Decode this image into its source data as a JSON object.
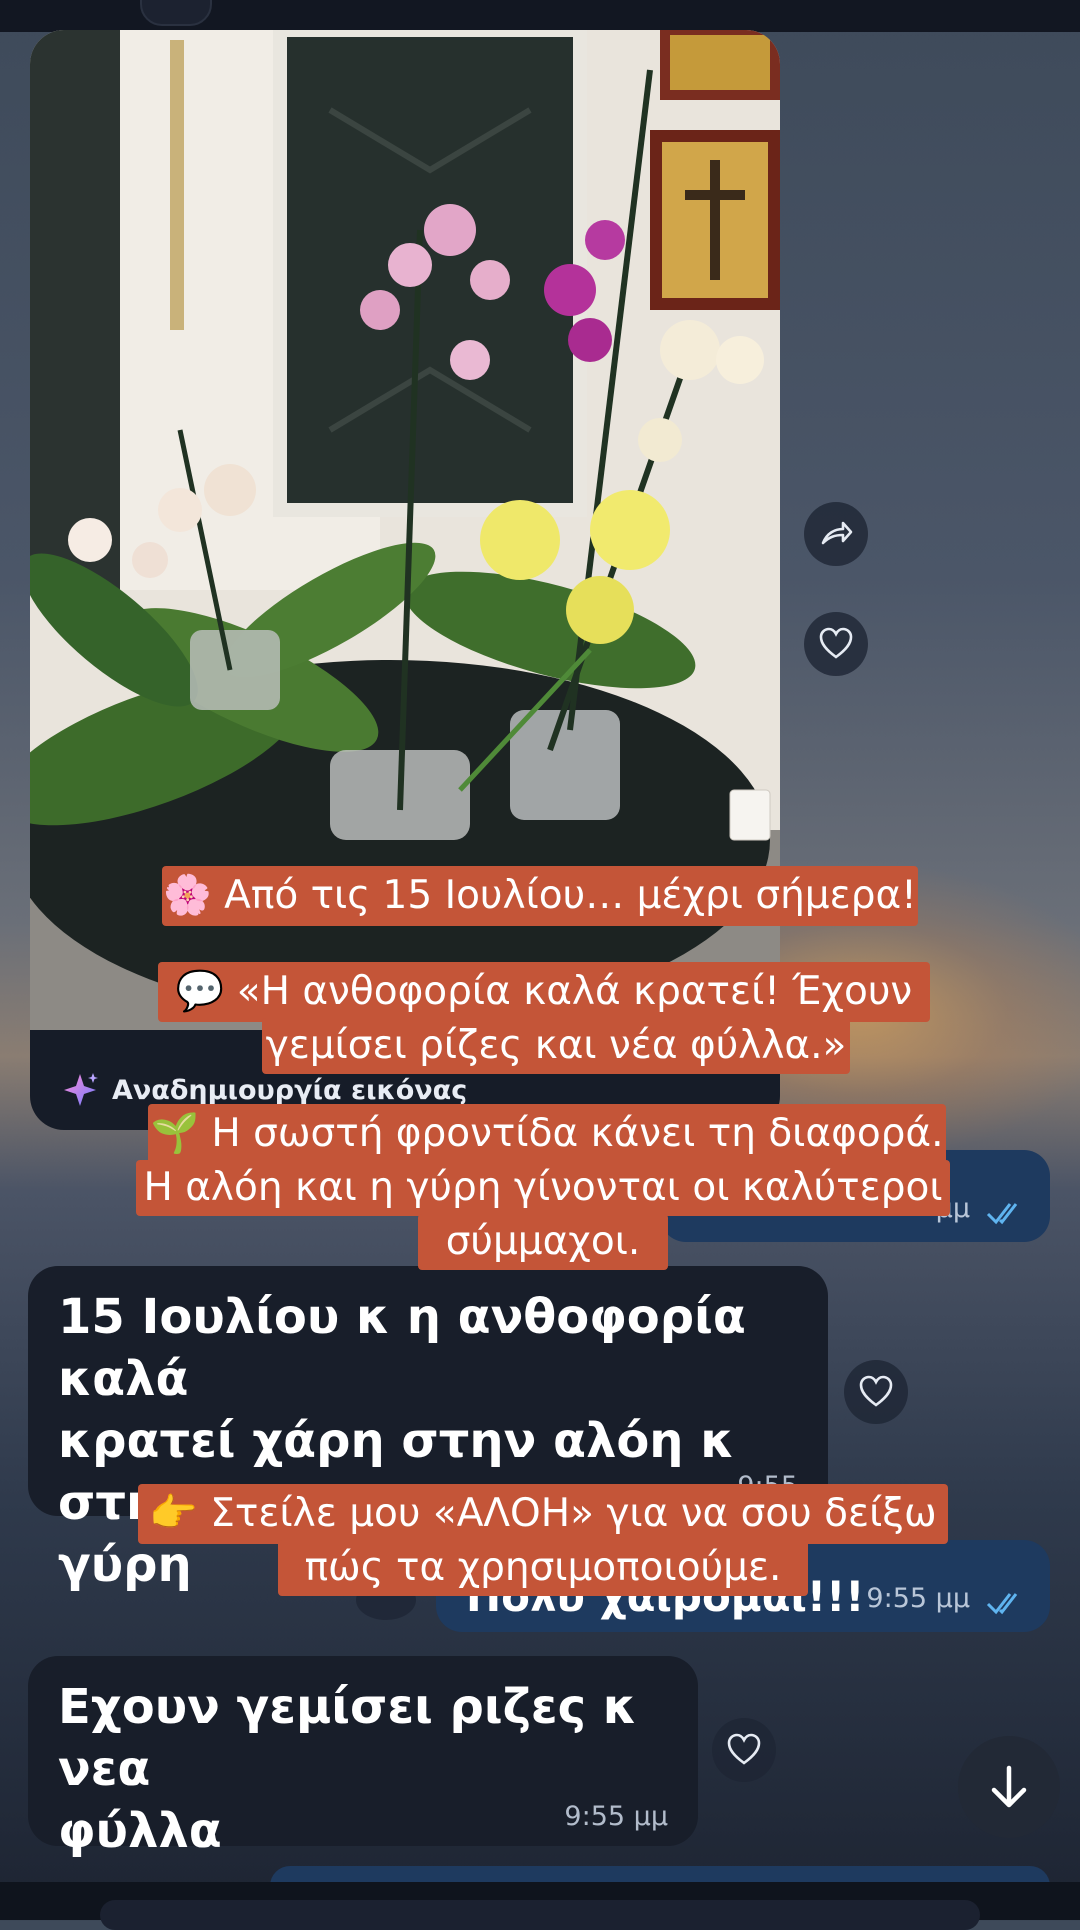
{
  "photo_bubble": {
    "image_alt": "Orchids in pots",
    "ai_label": "Αναδημιουργία εικόνας"
  },
  "messages": {
    "out1": {
      "text": "Πολύ χαίρομαι!!!",
      "time": "9:55 μμ"
    },
    "out0": {
      "time": "μμ"
    },
    "in1": {
      "line1": "15 Ιουλίου κ η ανθοφορία καλά",
      "line2": "κρατεί  χάρη στην αλόη κ στην",
      "line3": "γύρη",
      "time": "9:55"
    },
    "in2": {
      "line1": "Εχουν γεμίσει ριζες κ νεα",
      "line2": "φύλλα",
      "time": "9:55 μμ"
    }
  },
  "captions": {
    "c1": "🌸 Από τις 15 Ιουλίου… μέχρι σήμερα!",
    "c2_l1": "💬 «Η ανθοφορία καλά κρατεί! Έχουν",
    "c2_l2": "γεμίσει ρίζες και νέα φύλλα.»",
    "c3_l1": "🌱 Η σωστή φροντίδα κάνει τη διαφορά.",
    "c3_l2": "Η αλόη και η γύρη γίνονται οι καλύτεροι",
    "c3_l3": "σύμμαχοι.",
    "c4_l1": "👉 Στείλε μου «ΑΛΟΗ» για να σου δείξω",
    "c4_l2": "πώς τα  χρησιμοποιούμε."
  },
  "icons": {
    "share": "share-arrow-icon",
    "heart": "heart-icon",
    "sparkle": "sparkle-icon",
    "scroll_down": "arrow-down-icon",
    "ticks": "double-check-icon"
  },
  "colors": {
    "caption_bg": "#c45538",
    "outgoing_bubble": "#1e3a5f",
    "incoming_bubble": "#181e2a",
    "ticks": "#5fb4f0"
  }
}
